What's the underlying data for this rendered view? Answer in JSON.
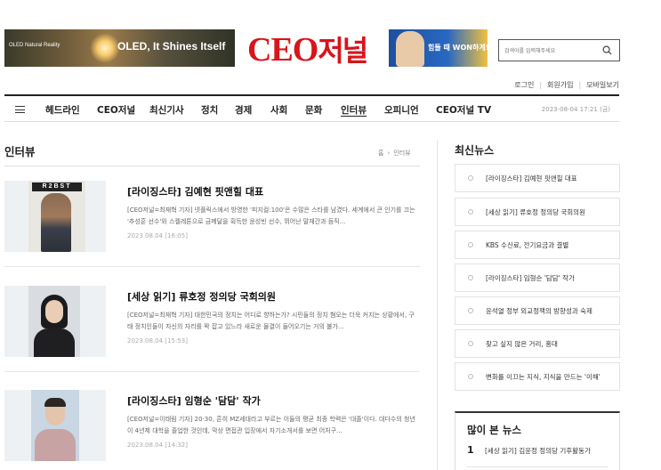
{
  "header": {
    "ad_left": {
      "small_text": "OLED Natural Reality",
      "big_text": "OLED, It Shines Itself"
    },
    "logo": {
      "latin": "CEO",
      "korean": "저널"
    },
    "ad_right": {
      "text": "힘들 때 WON하게!"
    },
    "search": {
      "placeholder": "검색어를 입력해주세요"
    },
    "util_links": [
      "로그인",
      "회원가입",
      "모바일보기"
    ]
  },
  "nav": {
    "items": [
      "헤드라인",
      "CEO저널",
      "최신기사",
      "정치",
      "경제",
      "사회",
      "문화",
      "인터뷰",
      "오피니언",
      "CEO저널 TV"
    ],
    "active": "인터뷰",
    "date": "2023-08-04 17:21 (금)"
  },
  "section": {
    "title": "인터뷰",
    "breadcrumb": [
      "홈",
      "인터뷰"
    ]
  },
  "articles": [
    {
      "title": "[라이징스타] 김예현 핏앤힐 대표",
      "summary": "[CEO저널=최재혁 기자] 넷플릭스에서 방영한 '피지컬:100'은 수많은 스타를 남겼다. 세계에서 큰 인기를 끄는 '추성훈 선수'와 스켈레톤으로 금메달을 획득한 윤성빈 선수, 뛰어난 말재간과 듬직...",
      "time": "2023.08.04 [16:05]",
      "thumb_brand": "R2BST"
    },
    {
      "title": "[세상 읽기] 류호정 정의당 국회의원",
      "summary": "[CEO저널=최재혁 기자] 대한민국의 정치는 어디로 향하는가? 시민들의 정치 혐오는 더욱 커지는 상황에서, 구태 정치인들이 자신의 자리를 꽉 잡고 있느라 새로운 물결이 들어오기는 거의 불가...",
      "time": "2023.08.04 [15:53]"
    },
    {
      "title": "[라이징스타] 임형순 '담담' 작가",
      "summary": "[CEO저널=이태림 기자] 20·30, 흔히 MZ세대라고 부르는 이들의 평균 최종 학력은 '대졸'이다. 대다수의 청년이 4년제 대학을 졸업한 것인데, 막상 면접관 입장에서 자기소개서를 보면 어처구...",
      "time": "2023.08.04 [14:32]"
    }
  ],
  "sidebar": {
    "latest_title": "최신뉴스",
    "latest": [
      "[라이징스타] 김예현 핏앤힐 대표",
      "[세상 읽기] 류호정 정의당 국회의원",
      "KBS 수신료, 전기요금과 결별",
      "[라이징스타] 임형순 '담담' 작가",
      "윤석열 정부 외교정책의 방향성과 숙제",
      "찾고 싶지 않은 거리, 홍대",
      "변화를 이끄는 지식, 지식을 만드는 '이해'"
    ],
    "popular_title": "많이 본 뉴스",
    "popular": [
      {
        "rank": "1",
        "title": "[세상 읽기] 김윤정 정의당 기후활동가"
      }
    ]
  }
}
